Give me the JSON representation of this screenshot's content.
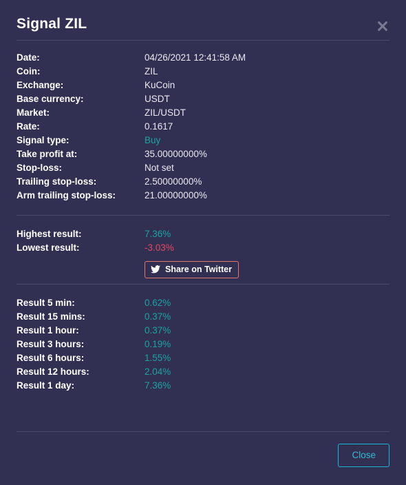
{
  "modal": {
    "title": "Signal ZIL",
    "close_icon": "close-x-icon"
  },
  "details": [
    {
      "label": "Date:",
      "value": "04/26/2021 12:41:58 AM",
      "tone": "default"
    },
    {
      "label": "Coin:",
      "value": "ZIL",
      "tone": "default"
    },
    {
      "label": "Exchange:",
      "value": "KuCoin",
      "tone": "default"
    },
    {
      "label": "Base currency:",
      "value": "USDT",
      "tone": "default"
    },
    {
      "label": "Market:",
      "value": "ZIL/USDT",
      "tone": "default"
    },
    {
      "label": "Rate:",
      "value": "0.1617",
      "tone": "default"
    },
    {
      "label": "Signal type:",
      "value": "Buy",
      "tone": "teal"
    },
    {
      "label": "Take profit at:",
      "value": "35.00000000%",
      "tone": "default"
    },
    {
      "label": "Stop-loss:",
      "value": "Not set",
      "tone": "default"
    },
    {
      "label": "Trailing stop-loss:",
      "value": "2.50000000%",
      "tone": "default"
    },
    {
      "label": "Arm trailing stop-loss:",
      "value": "21.00000000%",
      "tone": "default"
    }
  ],
  "summary": [
    {
      "label": "Highest result:",
      "value": "7.36%",
      "tone": "teal"
    },
    {
      "label": "Lowest result:",
      "value": "-3.03%",
      "tone": "red"
    }
  ],
  "share": {
    "label": "Share on Twitter",
    "icon": "twitter-bird-icon"
  },
  "results": [
    {
      "label": "Result 5 min:",
      "value": "0.62%",
      "tone": "teal"
    },
    {
      "label": "Result 15 mins:",
      "value": "0.37%",
      "tone": "teal"
    },
    {
      "label": "Result 1 hour:",
      "value": "0.37%",
      "tone": "teal"
    },
    {
      "label": "Result 3 hours:",
      "value": "0.19%",
      "tone": "teal"
    },
    {
      "label": "Result 6 hours:",
      "value": "1.55%",
      "tone": "teal"
    },
    {
      "label": "Result 12 hours:",
      "value": "2.04%",
      "tone": "teal"
    },
    {
      "label": "Result 1 day:",
      "value": "7.36%",
      "tone": "teal"
    }
  ],
  "footer": {
    "close_label": "Close"
  },
  "colors": {
    "background": "#313053",
    "divider": "#4b4a6b",
    "positive": "#1aa49f",
    "negative": "#e5485e",
    "twitter_border": "#e4756c",
    "close_button": "#1ab6d8",
    "text": "#ffffff"
  }
}
